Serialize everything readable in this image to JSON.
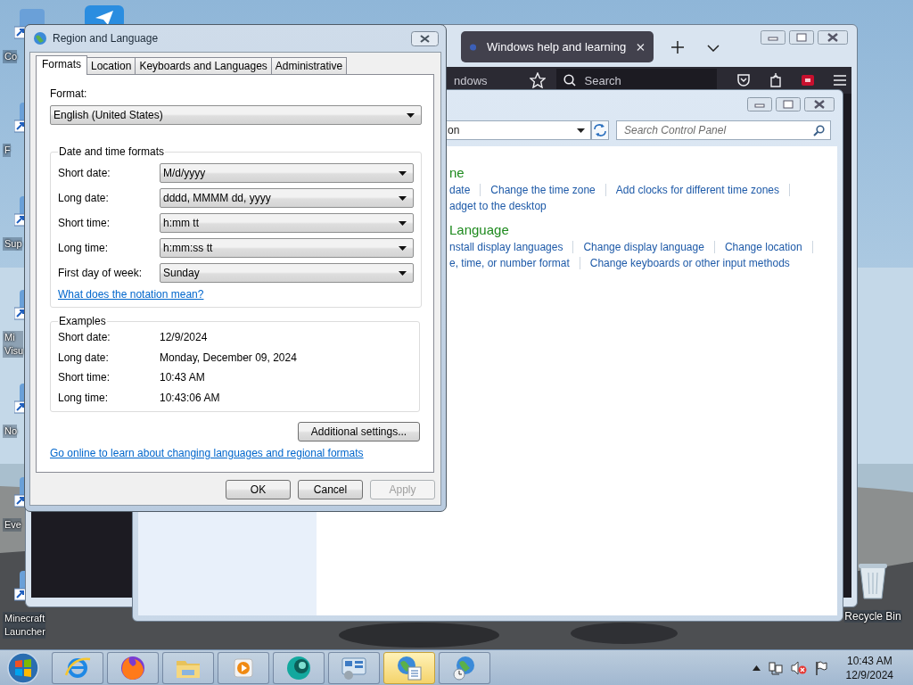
{
  "desktop": {
    "icons": [
      {
        "label": [
          "Co"
        ]
      },
      {
        "label": [
          "F"
        ]
      },
      {
        "label": [
          "Sup"
        ]
      },
      {
        "label": [
          "Mi",
          "Visu"
        ]
      },
      {
        "label": [
          "No"
        ]
      },
      {
        "label": [
          "Eve"
        ]
      },
      {
        "label": [
          "Minecraft",
          "Launcher"
        ]
      }
    ],
    "recycle_bin": {
      "label": "Recycle Bin"
    }
  },
  "browser": {
    "tabs": [
      {
        "title": "Windows help and learning",
        "selected": true
      }
    ],
    "address": "ndows",
    "search": {
      "placeholder": "Search"
    }
  },
  "control_panel": {
    "address": "on",
    "search": {
      "placeholder": "Search Control Panel"
    },
    "sections": [
      {
        "heading": "ne",
        "rows": [
          [
            "date",
            "Change the time zone",
            "Add clocks for different time zones"
          ],
          [
            "adget to the desktop"
          ]
        ]
      },
      {
        "heading": "Language",
        "rows": [
          [
            "nstall display languages",
            "Change display language",
            "Change location"
          ],
          [
            "e, time, or number format",
            "Change keyboards or other input methods"
          ]
        ]
      }
    ]
  },
  "dialog": {
    "title": "Region and Language",
    "tabs": [
      {
        "label": "Formats",
        "selected": true
      },
      {
        "label": "Location",
        "selected": false
      },
      {
        "label": "Keyboards and Languages",
        "selected": false
      },
      {
        "label": "Administrative",
        "selected": false
      }
    ],
    "format": {
      "label": "Format:",
      "value": "English (United States)"
    },
    "date_time": {
      "title": "Date and time formats",
      "rows": [
        {
          "label": "Short date:",
          "value": "M/d/yyyy"
        },
        {
          "label": "Long date:",
          "value": "dddd, MMMM dd, yyyy"
        },
        {
          "label": "Short time:",
          "value": "h:mm tt"
        },
        {
          "label": "Long time:",
          "value": "h:mm:ss tt"
        },
        {
          "label": "First day of week:",
          "value": "Sunday"
        }
      ],
      "link": "What does the notation mean?"
    },
    "examples": {
      "title": "Examples",
      "rows": [
        {
          "label": "Short date:",
          "value": "12/9/2024"
        },
        {
          "label": "Long date:",
          "value": "Monday, December 09, 2024"
        },
        {
          "label": "Short time:",
          "value": "10:43 AM"
        },
        {
          "label": "Long time:",
          "value": "10:43:06 AM"
        }
      ]
    },
    "additional_button": "Additional settings...",
    "online_link": "Go online to learn about changing languages and regional formats",
    "buttons": [
      {
        "label": "OK",
        "disabled": false
      },
      {
        "label": "Cancel",
        "disabled": false
      },
      {
        "label": "Apply",
        "disabled": true
      }
    ]
  },
  "taskbar": {
    "apps": [
      {
        "kind": "ie",
        "active": false
      },
      {
        "kind": "firefox",
        "active": false
      },
      {
        "kind": "folder",
        "active": false
      },
      {
        "kind": "media",
        "active": false
      },
      {
        "kind": "circle",
        "active": false
      },
      {
        "kind": "panel",
        "active": false
      },
      {
        "kind": "region",
        "active": true
      },
      {
        "kind": "datetime",
        "active": false
      }
    ],
    "clock": {
      "time": "10:43 AM",
      "date": "12/9/2024"
    }
  }
}
